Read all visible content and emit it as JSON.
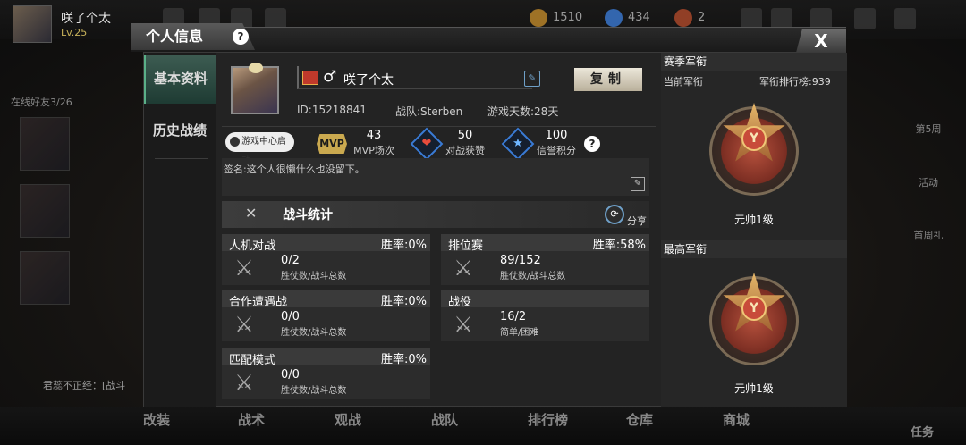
{
  "top": {
    "player_name": "咲了个太",
    "player_level": "Lv.25",
    "coins": "1510",
    "diamonds": "434",
    "tickets": "2"
  },
  "left": {
    "online": "在线好友3/26",
    "chat": "君蕊不正经：[战斗"
  },
  "right": {
    "items": [
      "第5周",
      "活动",
      "首周礼"
    ]
  },
  "bottom_nav": [
    "改装",
    "战术",
    "观战",
    "战队",
    "排行榜",
    "仓库",
    "商城",
    "任务"
  ],
  "modal": {
    "title": "个人信息",
    "help": "?",
    "close": "X",
    "tabs": [
      "基本资料",
      "历史战绩"
    ],
    "profile": {
      "name": "咲了个太",
      "gender_symbol": "♂",
      "copy_label": "复制",
      "id": "ID:15218841",
      "team": "战队:Sterben",
      "days": "游戏天数:28天",
      "game_center": "游戏中心启动",
      "mvp_label": "MVP",
      "mvp_count": "43",
      "mvp_caption": "MVP场次",
      "likes_count": "50",
      "likes_caption": "对战获赞",
      "credit_count": "100",
      "credit_caption": "信誉积分",
      "signature": "签名:这个人很懒什么也没留下。"
    },
    "battle": {
      "title": "战斗统计",
      "share": "分享",
      "cards": [
        {
          "title": "人机对战",
          "rate": "胜率:0%",
          "value": "0/2",
          "caption": "胜仗数/战斗总数"
        },
        {
          "title": "排位赛",
          "rate": "胜率:58%",
          "value": "89/152",
          "caption": "胜仗数/战斗总数"
        },
        {
          "title": "合作遭遇战",
          "rate": "胜率:0%",
          "value": "0/0",
          "caption": "胜仗数/战斗总数"
        },
        {
          "title": "战役",
          "rate": "",
          "value": "16/2",
          "caption": "简单/困难"
        },
        {
          "title": "匹配模式",
          "rate": "胜率:0%",
          "value": "0/0",
          "caption": "胜仗数/战斗总数"
        }
      ]
    },
    "rank": {
      "season_header": "赛季军衔",
      "current_label": "当前军衔",
      "leaderboard": "军衔排行榜:939",
      "current_name": "元帅1级",
      "highest_header": "最高军衔",
      "highest_name": "元帅1级"
    }
  }
}
